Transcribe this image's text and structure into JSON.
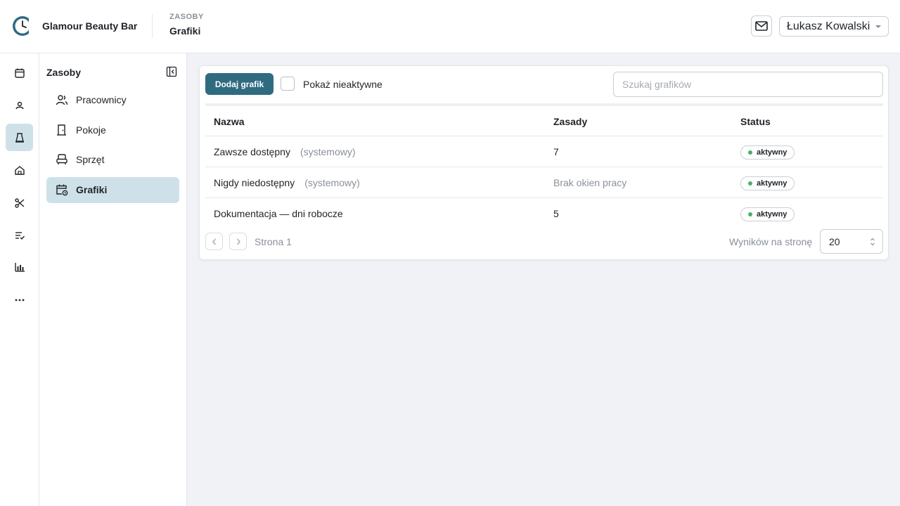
{
  "app": {
    "brand": "Glamour Beauty Bar"
  },
  "breadcrumb": {
    "section": "ZASOBY",
    "page": "Grafiki"
  },
  "user": {
    "name": "Łukasz Kowalski"
  },
  "rail": {
    "items": [
      {
        "icon": "calendar-icon"
      },
      {
        "icon": "clients-icon"
      },
      {
        "icon": "resources-icon",
        "active": true
      },
      {
        "icon": "home-icon"
      },
      {
        "icon": "scissors-icon"
      },
      {
        "icon": "checklist-icon"
      },
      {
        "icon": "chart-icon"
      },
      {
        "icon": "more-icon"
      }
    ]
  },
  "subnav": {
    "title": "Zasoby",
    "items": [
      {
        "label": "Pracownicy",
        "icon": "people-icon"
      },
      {
        "label": "Pokoje",
        "icon": "door-icon"
      },
      {
        "label": "Sprzęt",
        "icon": "chair-icon"
      },
      {
        "label": "Grafiki",
        "icon": "calendar-clock-icon",
        "active": true
      }
    ]
  },
  "toolbar": {
    "add_label": "Dodaj grafik",
    "show_inactive_label": "Pokaż nieaktywne",
    "search_placeholder": "Szukaj grafików"
  },
  "table": {
    "headers": {
      "name": "Nazwa",
      "rules": "Zasady",
      "status": "Status"
    },
    "rows": [
      {
        "name": "Zawsze dostępny",
        "tag": "(systemowy)",
        "rules": "7",
        "status": "aktywny"
      },
      {
        "name": "Nigdy niedostępny",
        "tag": "(systemowy)",
        "rules": "Brak okien pracy",
        "status": "aktywny"
      },
      {
        "name": "Dokumentacja — dni robocze",
        "tag": "",
        "rules": "5",
        "status": "aktywny"
      }
    ]
  },
  "pagination": {
    "page_label": "Strona 1",
    "per_page_label": "Wyników na stronę",
    "per_page_value": "20"
  },
  "colors": {
    "accent": "#2f6b80",
    "active_bg": "#cfe1e8",
    "status_dot": "#4caf63"
  }
}
